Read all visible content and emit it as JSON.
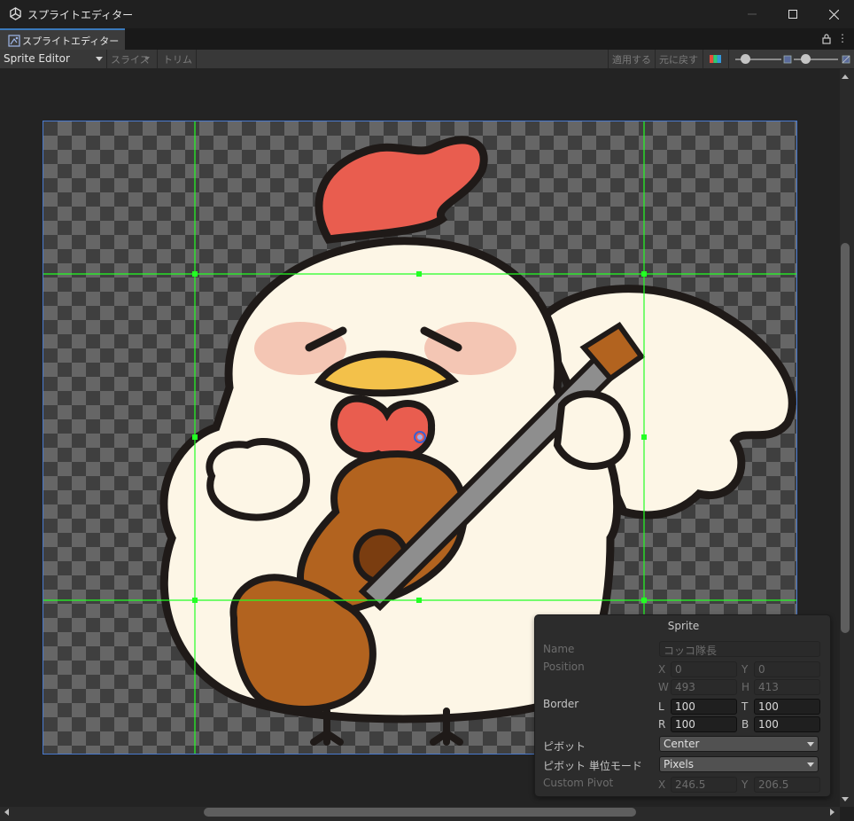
{
  "window": {
    "title": "スプライトエディター",
    "min_icon": "minimize-icon",
    "max_icon": "maximize-icon",
    "close_icon": "close-icon"
  },
  "tab": {
    "label": "スプライトエディター",
    "lock_icon": "lock-icon",
    "more_label": "⋮"
  },
  "toolbar": {
    "mode_dropdown": "Sprite Editor",
    "slice_label": "スライス",
    "trim_label": "トリム",
    "apply_label": "適用する",
    "revert_label": "元に戻す",
    "color_icon": "rgb-channel-icon",
    "zoom_level": 0.15,
    "mip_level": 0.2
  },
  "sprite_panel": {
    "title": "Sprite",
    "name_label": "Name",
    "name_value": "コッコ隊長",
    "position_label": "Position",
    "x_label": "X",
    "x_value": "0",
    "y_label": "Y",
    "y_value": "0",
    "w_label": "W",
    "w_value": "493",
    "h_label": "H",
    "h_value": "413",
    "border_label": "Border",
    "l_label": "L",
    "l_value": "100",
    "t_label": "T",
    "t_value": "100",
    "r_label": "R",
    "r_value": "100",
    "b_label": "B",
    "b_value": "100",
    "pivot_label": "ピボット",
    "pivot_value": "Center",
    "pivot_unit_label": "ピボット 単位モード",
    "pivot_unit_value": "Pixels",
    "custom_pivot_label": "Custom Pivot",
    "cpx_label": "X",
    "cpx_value": "246.5",
    "cpy_label": "Y",
    "cpy_value": "206.5"
  },
  "colors": {
    "border_lines": "#23ff23",
    "frame_outline": "#4a7bd1",
    "comb": "#e95d4f",
    "body": "#fdf6e6",
    "beak": "#f3c14a",
    "guitar": "#b2631f",
    "cheek": "#f4c6b4"
  }
}
